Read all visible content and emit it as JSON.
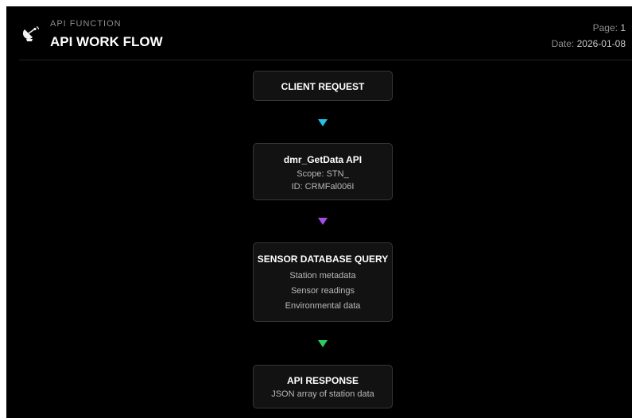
{
  "header": {
    "kicker": "API FUNCTION",
    "title": "API WORK FLOW",
    "page_label": "Page:",
    "page_value": "1",
    "date_label": "Date:",
    "date_value": "2026-01-08",
    "logo_icon": "satellite-dish-icon"
  },
  "flow": {
    "nodes": [
      {
        "title": "CLIENT REQUEST",
        "lines": []
      },
      {
        "title": "dmr_GetData API",
        "lines": [
          "Scope: STN_",
          "ID: CRMFal006I"
        ]
      },
      {
        "title": "SENSOR DATABASE QUERY",
        "lines": [
          "Station metadata",
          "Sensor readings",
          "Environmental data"
        ]
      },
      {
        "title": "API RESPONSE",
        "lines": [
          "JSON array of station data"
        ]
      }
    ],
    "arrow_colors": [
      "#24c1e8",
      "#a54de8",
      "#2ecc5e"
    ]
  }
}
